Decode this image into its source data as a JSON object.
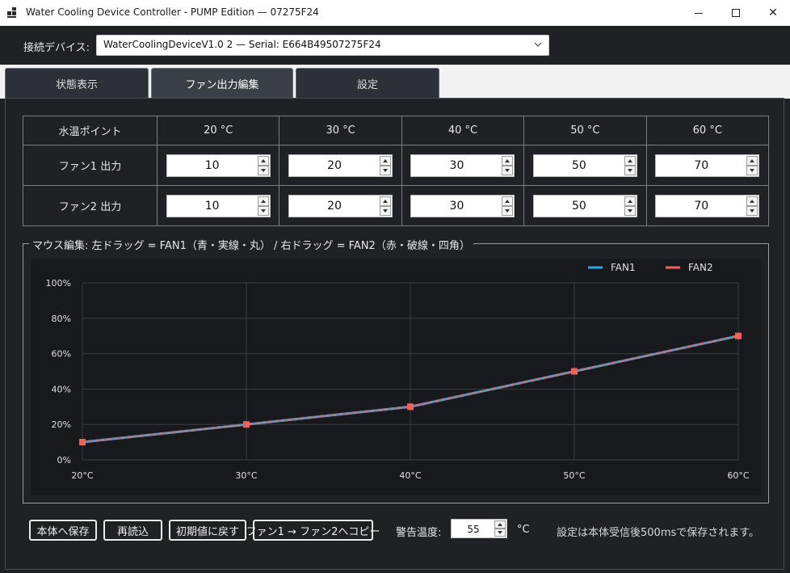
{
  "window": {
    "title": "Water Cooling Device Controller - PUMP Edition — 07275F24"
  },
  "device": {
    "label": "接続デバイス:",
    "selected": "WaterCoolingDeviceV1.0 2 — Serial: E664B49507275F24"
  },
  "tabs": [
    {
      "label": "状態表示",
      "active": false
    },
    {
      "label": "ファン出力編集",
      "active": true
    },
    {
      "label": "設定",
      "active": false
    }
  ],
  "table": {
    "corner": "水温ポイント",
    "temps": [
      "20 °C",
      "30 °C",
      "40 °C",
      "50 °C",
      "60 °C"
    ],
    "rows": [
      {
        "label": "ファン1 出力",
        "values": [
          "10",
          "20",
          "30",
          "50",
          "70"
        ]
      },
      {
        "label": "ファン2 出力",
        "values": [
          "10",
          "20",
          "30",
          "50",
          "70"
        ]
      }
    ]
  },
  "editor": {
    "caption": "マウス編集: 左ドラッグ = FAN1（青・実線・丸） / 右ドラッグ = FAN2（赤・破線・四角）"
  },
  "chart_data": {
    "type": "line",
    "x": [
      20,
      30,
      40,
      50,
      60
    ],
    "x_tick_labels": [
      "20°C",
      "30°C",
      "40°C",
      "50°C",
      "60°C"
    ],
    "y_tick_labels": [
      "0%",
      "20%",
      "40%",
      "60%",
      "80%",
      "100%"
    ],
    "xlim": [
      20,
      60
    ],
    "ylim": [
      0,
      100
    ],
    "grid": true,
    "legend": "top-right",
    "series": [
      {
        "name": "FAN1",
        "values": [
          10,
          20,
          30,
          50,
          70
        ],
        "color": "#29a9e1",
        "style": "solid",
        "marker": "circle"
      },
      {
        "name": "FAN2",
        "values": [
          10,
          20,
          30,
          50,
          70
        ],
        "color": "#f0635a",
        "style": "dashed",
        "marker": "square"
      }
    ]
  },
  "toolbar": {
    "save_label": "本体へ保存",
    "reload_label": "再読込",
    "default_label": "初期値に戻す",
    "copy_label": "ファン1 → ファン2へコピー",
    "warn_label": "警告温度:",
    "warn_value": "55",
    "warn_unit": "°C",
    "hint": "設定は本体受信後500msで保存されます。"
  }
}
